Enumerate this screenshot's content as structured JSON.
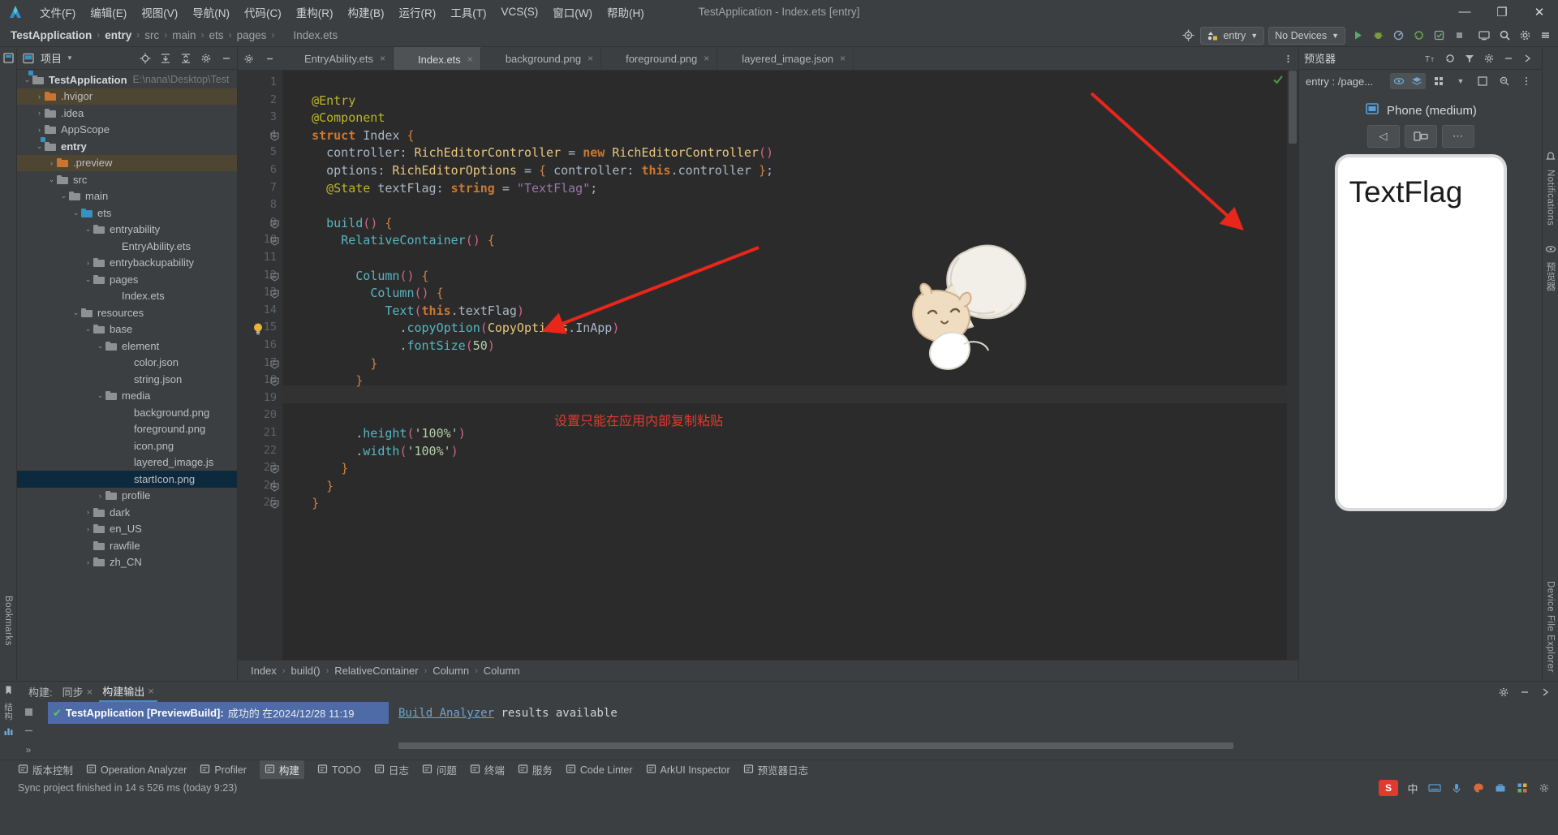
{
  "window": {
    "title": "TestApplication - Index.ets [entry]",
    "minimize": "—",
    "maximize": "❐",
    "close": "✕"
  },
  "menu": [
    {
      "label": "文件(F)"
    },
    {
      "label": "编辑(E)"
    },
    {
      "label": "视图(V)"
    },
    {
      "label": "导航(N)"
    },
    {
      "label": "代码(C)"
    },
    {
      "label": "重构(R)"
    },
    {
      "label": "构建(B)"
    },
    {
      "label": "运行(R)"
    },
    {
      "label": "工具(T)"
    },
    {
      "label": "VCS(S)"
    },
    {
      "label": "窗口(W)"
    },
    {
      "label": "帮助(H)"
    }
  ],
  "breadcrumb": {
    "items": [
      "TestApplication",
      "entry",
      "src",
      "main",
      "ets",
      "pages",
      "Index.ets"
    ],
    "separator": "›"
  },
  "toolbar": {
    "run_config": "entry",
    "device": "No Devices",
    "target_icon": "target-icon",
    "run_icon": "run-icon",
    "debug_icon": "debug-icon",
    "profile_icon": "profile-icon",
    "sync_icon": "sync-icon",
    "coverage_icon": "coverage-icon",
    "stop_icon": "stop-icon",
    "device_manager_icon": "device-manager-icon",
    "search_icon": "search-icon",
    "settings_icon": "settings-icon",
    "menu_icon": "hamburger-icon"
  },
  "left_rail": {
    "bookmarks": "Bookmarks",
    "structure_icon": "structure-icon"
  },
  "project": {
    "title": "项目",
    "header_icons": [
      "locate-icon",
      "expand-all-icon",
      "collapse-all-icon",
      "settings-icon",
      "hide-icon"
    ],
    "tree": [
      {
        "label": "TestApplication",
        "path": "E:\\nana\\Desktop\\Test",
        "depth": 0,
        "arrow": "⌄",
        "icon": "module-folder",
        "bold": true
      },
      {
        "label": ".hvigor",
        "depth": 1,
        "arrow": "›",
        "icon": "folder-orange",
        "highlight": true
      },
      {
        "label": ".idea",
        "depth": 1,
        "arrow": "›",
        "icon": "folder"
      },
      {
        "label": "AppScope",
        "depth": 1,
        "arrow": "›",
        "icon": "folder"
      },
      {
        "label": "entry",
        "depth": 1,
        "arrow": "⌄",
        "icon": "module-folder",
        "bold": true
      },
      {
        "label": ".preview",
        "depth": 2,
        "arrow": "›",
        "icon": "folder-orange",
        "highlight": true
      },
      {
        "label": "src",
        "depth": 2,
        "arrow": "⌄",
        "icon": "folder"
      },
      {
        "label": "main",
        "depth": 3,
        "arrow": "⌄",
        "icon": "folder"
      },
      {
        "label": "ets",
        "depth": 4,
        "arrow": "⌄",
        "icon": "folder-blue"
      },
      {
        "label": "entryability",
        "depth": 5,
        "arrow": "⌄",
        "icon": "folder"
      },
      {
        "label": "EntryAbility.ets",
        "depth": 6,
        "arrow": "",
        "icon": "ets-file"
      },
      {
        "label": "entrybackupability",
        "depth": 5,
        "arrow": "›",
        "icon": "folder"
      },
      {
        "label": "pages",
        "depth": 5,
        "arrow": "⌄",
        "icon": "folder"
      },
      {
        "label": "Index.ets",
        "depth": 6,
        "arrow": "",
        "icon": "ets-file"
      },
      {
        "label": "resources",
        "depth": 4,
        "arrow": "⌄",
        "icon": "folder"
      },
      {
        "label": "base",
        "depth": 5,
        "arrow": "⌄",
        "icon": "folder"
      },
      {
        "label": "element",
        "depth": 6,
        "arrow": "⌄",
        "icon": "folder"
      },
      {
        "label": "color.json",
        "depth": 7,
        "arrow": "",
        "icon": "json-file"
      },
      {
        "label": "string.json",
        "depth": 7,
        "arrow": "",
        "icon": "json-file"
      },
      {
        "label": "media",
        "depth": 6,
        "arrow": "⌄",
        "icon": "folder"
      },
      {
        "label": "background.png",
        "depth": 7,
        "arrow": "",
        "icon": "img-file"
      },
      {
        "label": "foreground.png",
        "depth": 7,
        "arrow": "",
        "icon": "img-file"
      },
      {
        "label": "icon.png",
        "depth": 7,
        "arrow": "",
        "icon": "img-file"
      },
      {
        "label": "layered_image.js",
        "depth": 7,
        "arrow": "",
        "icon": "json-file"
      },
      {
        "label": "startIcon.png",
        "depth": 7,
        "arrow": "",
        "icon": "img-file",
        "selected": true
      },
      {
        "label": "profile",
        "depth": 6,
        "arrow": "›",
        "icon": "folder"
      },
      {
        "label": "dark",
        "depth": 5,
        "arrow": "›",
        "icon": "folder"
      },
      {
        "label": "en_US",
        "depth": 5,
        "arrow": "›",
        "icon": "folder"
      },
      {
        "label": "rawfile",
        "depth": 5,
        "arrow": "",
        "icon": "folder"
      },
      {
        "label": "zh_CN",
        "depth": 5,
        "arrow": "›",
        "icon": "folder"
      }
    ]
  },
  "editor": {
    "tabs": [
      {
        "label": "EntryAbility.ets",
        "icon": "ets-file",
        "active": false
      },
      {
        "label": "Index.ets",
        "icon": "ets-file",
        "active": true
      },
      {
        "label": "background.png",
        "icon": "img-file",
        "active": false
      },
      {
        "label": "foreground.png",
        "icon": "img-file",
        "active": false
      },
      {
        "label": "layered_image.json",
        "icon": "json-file",
        "active": false
      }
    ],
    "tab_close": "×",
    "line_count": 25,
    "highlighted_line": 15,
    "inspection_ok_icon": "check-icon",
    "bulb_icon": "intention-bulb-icon",
    "annotation": "设置只能在应用内部复制粘贴",
    "breadcrumbs": [
      "Index",
      "build()",
      "RelativeContainer",
      "Column",
      "Column"
    ],
    "breadcrumb_sep": "›",
    "code_lines": [
      {
        "n": 1,
        "text": ""
      },
      {
        "n": 2,
        "text": "  @Entry"
      },
      {
        "n": 3,
        "text": "  @Component"
      },
      {
        "n": 4,
        "text": "  struct Index {"
      },
      {
        "n": 5,
        "text": "    controller: RichEditorController = new RichEditorController()"
      },
      {
        "n": 6,
        "text": "    options: RichEditorOptions = { controller: this.controller };"
      },
      {
        "n": 7,
        "text": "    @State textFlag: string = \"TextFlag\";"
      },
      {
        "n": 8,
        "text": ""
      },
      {
        "n": 9,
        "text": "    build() {"
      },
      {
        "n": 10,
        "text": "      RelativeContainer() {"
      },
      {
        "n": 11,
        "text": ""
      },
      {
        "n": 12,
        "text": "        Column() {"
      },
      {
        "n": 13,
        "text": "          Column() {"
      },
      {
        "n": 14,
        "text": "            Text(this.textFlag)"
      },
      {
        "n": 15,
        "text": "              .copyOption(CopyOptions.InApp)"
      },
      {
        "n": 16,
        "text": "              .fontSize(50)"
      },
      {
        "n": 17,
        "text": "          }"
      },
      {
        "n": 18,
        "text": "        }"
      },
      {
        "n": 19,
        "text": ""
      },
      {
        "n": 20,
        "text": ""
      },
      {
        "n": 21,
        "text": "        .height('100%')"
      },
      {
        "n": 22,
        "text": "        .width('100%')"
      },
      {
        "n": 23,
        "text": "      }"
      },
      {
        "n": 24,
        "text": "    }"
      },
      {
        "n": 25,
        "text": "  }"
      }
    ]
  },
  "previewer": {
    "title": "预览器",
    "page_label": "entry : /page...",
    "device_name": "Phone (medium)",
    "device_icon": "phone-icon",
    "nav_back_icon": "back-icon",
    "nav_rotate_icon": "rotate-icon",
    "nav_more_icon": "more-icon",
    "header_icons": [
      "font-size-icon",
      "refresh-icon",
      "filter-icon",
      "settings-icon",
      "minimize-icon",
      "hide-icon"
    ],
    "sub_icons": [
      "eye-icon",
      "layers-icon",
      "grid-icon",
      "chevron-down-icon",
      "frame-icon",
      "zoom-out-icon",
      "more-icon"
    ],
    "preview_text": "TextFlag",
    "rail": [
      "Notifications",
      "预览器",
      "Device File Explorer"
    ]
  },
  "bottom_panel": {
    "tabs": [
      {
        "label": "构建:",
        "static": true
      },
      {
        "label": "同步",
        "close": "×"
      },
      {
        "label": "构建输出",
        "close": "×",
        "selected": true
      }
    ],
    "build_result": {
      "status_icon": "success-check-icon",
      "title": "TestApplication [PreviewBuild]:",
      "detail": "成功的 在2024/12/28 11:19"
    },
    "analyzer_link": "Build Analyzer",
    "analyzer_text": "results available",
    "expand_icon": "»",
    "settings_icon": "settings-icon",
    "minimize_icon": "minimize-icon",
    "hide_icon": "hide-icon"
  },
  "status_tools": [
    {
      "label": "版本控制",
      "icon": "vcs-icon"
    },
    {
      "label": "Operation Analyzer",
      "icon": "analyzer-icon"
    },
    {
      "label": "Profiler",
      "icon": "profiler-icon"
    },
    {
      "label": "构建",
      "icon": "build-icon",
      "selected": true
    },
    {
      "label": "TODO",
      "icon": "todo-icon"
    },
    {
      "label": "日志",
      "icon": "log-icon"
    },
    {
      "label": "问题",
      "icon": "problems-icon"
    },
    {
      "label": "终端",
      "icon": "terminal-icon"
    },
    {
      "label": "服务",
      "icon": "services-icon"
    },
    {
      "label": "Code Linter",
      "icon": "linter-icon"
    },
    {
      "label": "ArkUI Inspector",
      "icon": "inspector-icon"
    },
    {
      "label": "预览器日志",
      "icon": "preview-log-icon"
    }
  ],
  "status_bar": {
    "message": "Sync project finished in 14 s 526 ms (today 9:23)",
    "tray": [
      "sogou-icon",
      "中",
      "keyboard-icon",
      "mic-icon",
      "palette-icon",
      "toolbox-icon",
      "grid-icon",
      "settings-icon"
    ]
  },
  "colors": {
    "accent_blue": "#4a88c7",
    "annotation_red": "#e03a2f",
    "selection_blue": "#0d293e",
    "build_row_blue": "#4e6ba8",
    "editor_bg": "#2b2b2b",
    "panel_bg": "#3c3f41"
  }
}
